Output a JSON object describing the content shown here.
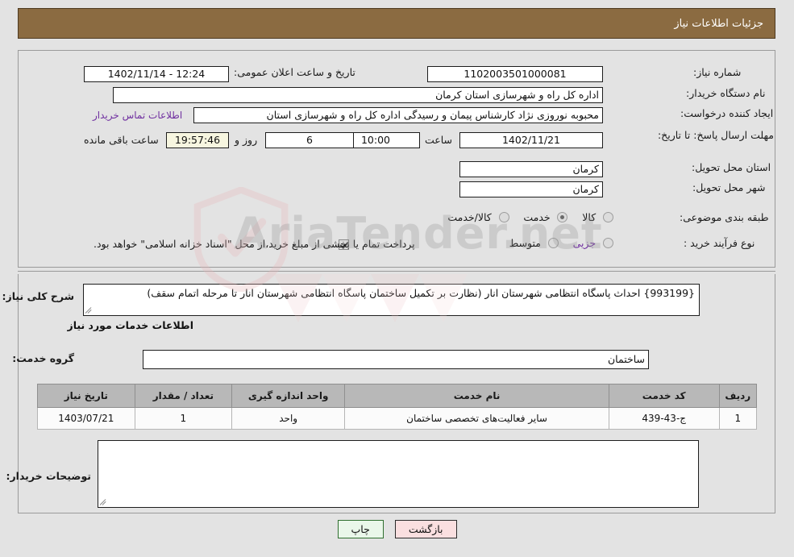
{
  "header": {
    "title": "جزئیات اطلاعات نیاز"
  },
  "colors": {
    "header_bg": "#8b6b41",
    "page_bg": "#e3e3e3",
    "link": "#7030a0",
    "timer_bg": "#f7f6e0",
    "table_header_bg": "#b8b8b8",
    "btn_back_bg": "#fadfe0",
    "btn_print_bg": "#eaf7ea"
  },
  "form": {
    "need_number_label": "شماره نیاز:",
    "need_number_value": "1102003501000081",
    "announce_datetime_label": "تاریخ و ساعت اعلان عمومی:",
    "announce_datetime_value": "1402/11/14 - 12:24",
    "buyer_org_label": "نام دستگاه خریدار:",
    "buyer_org_value": "اداره کل راه و شهرسازی استان کرمان",
    "requester_label": "ایجاد کننده درخواست:",
    "requester_value": "محبوبه نوروزی نژاد کارشناس پیمان و رسیدگی اداره کل راه و شهرسازی استان",
    "buyer_contact_link": "اطلاعات تماس خریدار",
    "deadline_label": "مهلت ارسال پاسخ: تا تاریخ:",
    "deadline_date": "1402/11/21",
    "deadline_hour_label": "ساعت",
    "deadline_hour": "10:00",
    "remaining_days": "6",
    "remaining_days_label": "روز و",
    "remaining_timer": "19:57:46",
    "remaining_suffix": "ساعت باقی مانده",
    "province_label": "استان محل تحویل:",
    "province_value": "کرمان",
    "city_label": "شهر محل تحویل:",
    "city_value": "کرمان",
    "category_label": "طبقه بندی موضوعی:",
    "category_options": [
      {
        "label": "کالا",
        "selected": false
      },
      {
        "label": "خدمت",
        "selected": true
      },
      {
        "label": "کالا/خدمت",
        "selected": false
      }
    ],
    "process_label": "نوع فرآیند خرید :",
    "process_options": [
      {
        "label": "جزیی",
        "selected": false
      },
      {
        "label": "متوسط",
        "selected": false
      }
    ],
    "treasury_checkbox_checked": true,
    "treasury_text": "پرداخت تمام یا بخشی از مبلغ خرید،از محل \"اسناد خزانه اسلامی\" خواهد بود."
  },
  "description": {
    "label": "شرح کلی نیاز:",
    "value": "{993199} احداث پاسگاه انتظامی شهرستان انار (نظارت بر تکمیل ساختمان پاسگاه انتظامی شهرستان انار تا مرحله اتمام سقف)"
  },
  "services": {
    "section_title": "اطلاعات خدمات مورد نیاز",
    "group_label": "گروه خدمت:",
    "group_value": "ساختمان",
    "table": {
      "columns": [
        "ردیف",
        "کد خدمت",
        "نام خدمت",
        "واحد اندازه گیری",
        "تعداد / مقدار",
        "تاریخ نیاز"
      ],
      "rows": [
        {
          "radif": "1",
          "code": "ج-43-439",
          "name": "سایر فعالیت‌های تخصصی ساختمان",
          "unit": "واحد",
          "qty": "1",
          "need_date": "1403/07/21"
        }
      ]
    }
  },
  "buyer_notes": {
    "label": "توضیحات خریدار:",
    "value": ""
  },
  "buttons": {
    "back": "بازگشت",
    "print": "چاپ"
  },
  "watermark": {
    "text": "AriaTender.net"
  }
}
